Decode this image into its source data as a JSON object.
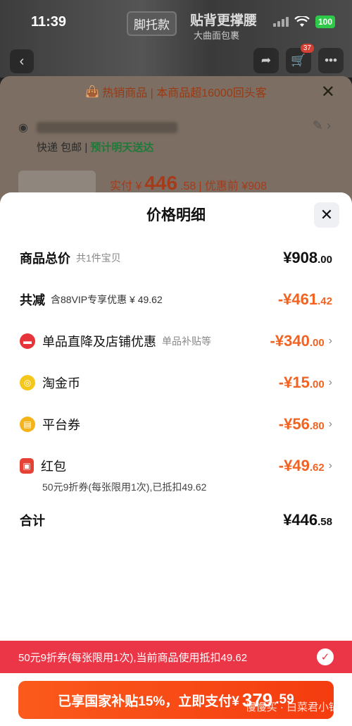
{
  "status_bar": {
    "time": "11:39",
    "battery": "100"
  },
  "background": {
    "tag": "脚托款",
    "hero_title": "贴背更撑腰",
    "hero_subtitle": "大曲面包裹",
    "cart_count": "37",
    "hot_banner": "热销商品 | 本商品超16000回头客",
    "shipping": {
      "express": "快递 包邮",
      "eta": "预计明天送达"
    },
    "price": {
      "prefix": "实付 ¥",
      "amount_int": "446",
      "amount_dec": ".58",
      "before": "| 优惠前 ¥908"
    }
  },
  "sheet": {
    "title": "价格明细",
    "rows": {
      "total": {
        "label": "商品总价",
        "sub": "共1件宝贝",
        "int": "¥908",
        "dec": ".00"
      },
      "reduce": {
        "label": "共减",
        "sub": "含88VIP专享优惠 ¥ 49.62",
        "int": "-¥461",
        "dec": ".42"
      },
      "direct": {
        "label": "单品直降及店铺优惠",
        "sub": "单品补贴等",
        "int": "-¥340",
        "dec": ".00"
      },
      "coin": {
        "label": "淘金币",
        "int": "-¥15",
        "dec": ".00"
      },
      "platform": {
        "label": "平台券",
        "int": "-¥56",
        "dec": ".80"
      },
      "redpacket": {
        "label": "红包",
        "int": "-¥49",
        "dec": ".62"
      },
      "sum": {
        "label": "合计",
        "int": "¥446",
        "dec": ".58"
      }
    },
    "redpacket_note": "50元9折券(每张限用1次),已抵扣49.62"
  },
  "coupon_bar": {
    "text": "50元9折券(每张限用1次),当前商品使用抵扣49.62"
  },
  "pay_button": {
    "label": "已享国家补贴15%，立即支付¥",
    "int": "379",
    "dec": ".59"
  },
  "watermark": "慢慢买 · 白菜君小锅",
  "colors": {
    "orange": "#f26322",
    "coupon_red": "#eb3648",
    "pay_orange": "#f43c0f"
  }
}
